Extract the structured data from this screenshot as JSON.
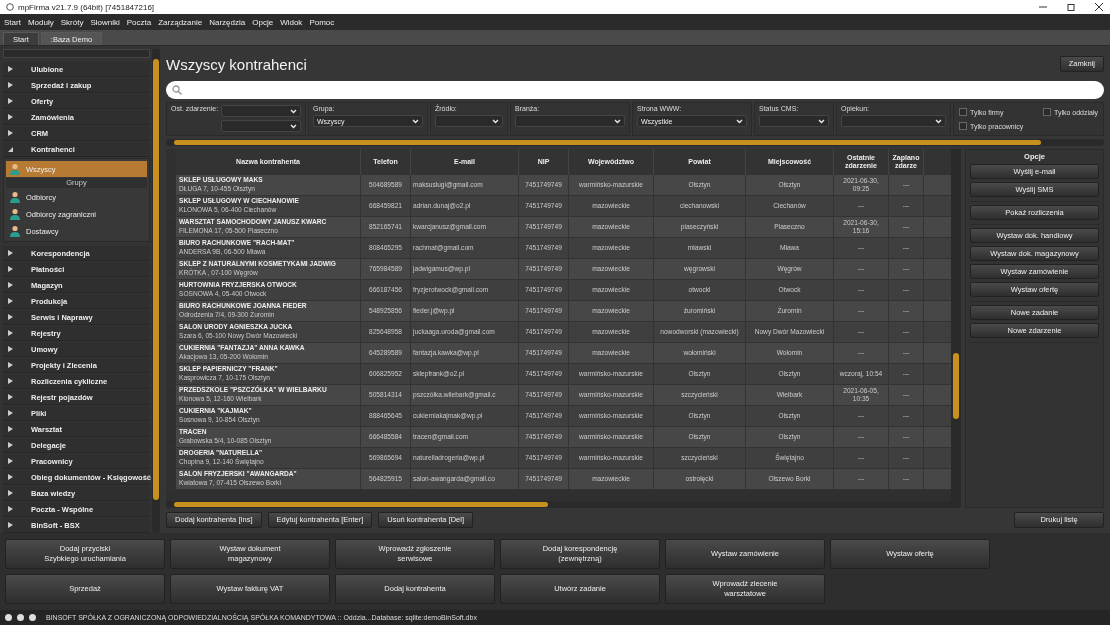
{
  "window": {
    "title": "mpFirma v21.7.9 (64bit) [7451847216]"
  },
  "menu": [
    "Start",
    "Moduły",
    "Skróty",
    "Słowniki",
    "Poczta",
    "Zarządzanie",
    "Narzędzia",
    "Opcje",
    "Widok",
    "Pomoc"
  ],
  "tabs": [
    {
      "label": "Start",
      "selected": false
    },
    {
      "label": ":Baza Demo",
      "selected": true
    }
  ],
  "sidebar": {
    "groups": [
      {
        "label": "Ulubione",
        "expanded": false
      },
      {
        "label": "Sprzedaż i zakup",
        "expanded": false
      },
      {
        "label": "Oferty",
        "expanded": false
      },
      {
        "label": "Zamówienia",
        "expanded": false
      },
      {
        "label": "CRM",
        "expanded": false
      },
      {
        "label": "Kontrahenci",
        "expanded": true,
        "children": [
          {
            "kind": "item",
            "label": "Wszyscy",
            "selected": true
          },
          {
            "kind": "header",
            "label": "Grupy"
          },
          {
            "kind": "item",
            "label": "Odbiorcy",
            "selected": false
          },
          {
            "kind": "item",
            "label": "Odbiorcy zagraniczni",
            "selected": false
          },
          {
            "kind": "item",
            "label": "Dostawcy",
            "selected": false
          }
        ]
      },
      {
        "label": "Korespondencja",
        "expanded": false
      },
      {
        "label": "Płatności",
        "expanded": false
      },
      {
        "label": "Magazyn",
        "expanded": false
      },
      {
        "label": "Produkcja",
        "expanded": false
      },
      {
        "label": "Serwis i Naprawy",
        "expanded": false
      },
      {
        "label": "Rejestry",
        "expanded": false
      },
      {
        "label": "Umowy",
        "expanded": false
      },
      {
        "label": "Projekty i Zlecenia",
        "expanded": false
      },
      {
        "label": "Rozliczenia cykliczne",
        "expanded": false
      },
      {
        "label": "Rejestr pojazdów",
        "expanded": false
      },
      {
        "label": "Pliki",
        "expanded": false
      },
      {
        "label": "Warsztat",
        "expanded": false
      },
      {
        "label": "Delegacje",
        "expanded": false
      },
      {
        "label": "Pracownicy",
        "expanded": false
      },
      {
        "label": "Obieg dokumentów - Księgowość",
        "expanded": false
      },
      {
        "label": "Baza wiedzy",
        "expanded": false
      },
      {
        "label": "Poczta - Wspólne",
        "expanded": false
      },
      {
        "label": "BinSoft - BSX",
        "expanded": false
      }
    ]
  },
  "page": {
    "title": "Wszyscy kontrahenci",
    "close_button": "Zamknij"
  },
  "filters": [
    {
      "kind": "side",
      "label": "Ost. zdarzenie:"
    },
    {
      "kind": "top",
      "label": "Grupa:",
      "value": "Wszyscy"
    },
    {
      "kind": "top",
      "label": "Źródło:"
    },
    {
      "kind": "top",
      "label": "Branża:"
    },
    {
      "kind": "top",
      "label": "Strona WWW:",
      "value": "Wszystkie"
    },
    {
      "kind": "top",
      "label": "Status CMS:"
    },
    {
      "kind": "top",
      "label": "Opiekun:"
    }
  ],
  "checkboxes": [
    {
      "label": "Tylko firmy",
      "checked": false
    },
    {
      "label": "Tylko oddziały",
      "checked": false
    },
    {
      "label": "Tylko pracownicy",
      "checked": false
    }
  ],
  "table": {
    "columns": [
      "Nazwa kontrahenta",
      "Telefon",
      "E-mail",
      "NIP",
      "Województwo",
      "Powiat",
      "Miejscowość",
      "Ostatnie zdarzenie",
      "Zaplano zdarze"
    ],
    "rows": [
      [
        "**SKLEP USŁUGOWY MAKS**\nDŁUGA 7, 10-455 Olsztyn",
        "504689589",
        "maksuslugi@gmail.com",
        "7451749749",
        "warmińsko-mazurskie",
        "Olsztyn",
        "Olsztyn",
        "2021-06-30, 09:25",
        "---"
      ],
      [
        "**SKLEP USŁUGOWY W CIECHANOWIE**\nKLONOWA 5, 06-400 Ciechanów",
        "668459821",
        "adrian.dunaj@o2.pl",
        "7451749749",
        "mazowieckie",
        "ciechanowski",
        "Ciechanów",
        "---",
        "---"
      ],
      [
        "**WARSZTAT SAMOCHODOWY JANUSZ KWARC**\nFILEMONA 17, 05-500 Piaseczno",
        "852165741",
        "kwarcjanusz@gmail.com",
        "7451749749",
        "mazowieckie",
        "piaseczyński",
        "Piaseczno",
        "2021-06-30, 15:16",
        "---"
      ],
      [
        "**BIURO RACHUNKOWE \"RACH-MAT\"**\nANDERSA 9B, 06-500 Mława",
        "808465295",
        "rachmat@gmail.com",
        "7451749749",
        "mazowieckie",
        "mławski",
        "Mława",
        "---",
        "---"
      ],
      [
        "**SKLEP Z NATURALNYMI KOSMETYKAMI JADWIG**\nKRÓTKA , 07-100 Węgrów",
        "765984589",
        "jadwigamus@wp.pl",
        "7451749749",
        "mazowieckie",
        "węgrowski",
        "Węgrów",
        "---",
        "---"
      ],
      [
        "**HURTOWNIA FRYZJERSKA OTWOCK**\nSOSNOWA 4, 05-400 Otwock",
        "666187456",
        "fryzjerotwock@gmail.com",
        "7451749749",
        "mazowieckie",
        "otwocki",
        "Otwock",
        "---",
        "---"
      ],
      [
        "**BIURO RACHUNKOWE JOANNA FIEDER**\nOdrodzenia 7/4, 09-300 Żuromin",
        "548925856",
        "fieder.j@wp.pl",
        "7451749749",
        "mazowieckie",
        "żuromiński",
        "Żuromin",
        "---",
        "---"
      ],
      [
        "**SALON URODY AGNIESZKA JUCKA**\nSzara 6, 05-100 Nowy Dwór Mazowiecki",
        "825648958",
        "juckaaga.uroda@gmail.com",
        "7451749749",
        "mazowieckie",
        "nowodworski (mazowiecki)",
        "Nowy Dwór Mazowiecki",
        "---",
        "---"
      ],
      [
        "**CUKIERNIA \"FANTAZJA\" ANNA KAWKA**\nAkacjowa 13, 05-200 Wołomin",
        "645289589",
        "fantazja.kawka@wp.pl",
        "7451749749",
        "mazowieckie",
        "wołomiński",
        "Wołomin",
        "---",
        "---"
      ],
      [
        "**SKLEP PAPIERNICZY \"FRANK\"**\nKasprowicza 7, 10-175 Olsztyn",
        "606825952",
        "sklepfrank@o2.pl",
        "7451749749",
        "warmińsko-mazurskie",
        "Olsztyn",
        "Olsztyn",
        "wczoraj, 10:54",
        "---"
      ],
      [
        "**PRZEDSZKOLE \"PSZCZÓŁKA\" W WIELBARKU**\nKlonowa 5, 12-160 Wielbark",
        "505814314",
        "pszczółka.wilebark@gmail.c",
        "7451749749",
        "warmińsko-mazurskie",
        "szczycieński",
        "Wielbark",
        "2021-06-05, 10:35",
        "---"
      ],
      [
        "**CUKIERNIA \"KAJMAK\"**\nSosnowa 9, 10-854 Olsztyn",
        "888465645",
        "cukierniakajmak@wp.pl",
        "7451749749",
        "warmińsko-mazurskie",
        "Olsztyn",
        "Olsztyn",
        "---",
        "---"
      ],
      [
        "**TRACEN**\nGrabowska 5/4, 10-085 Olsztyn",
        "666485584",
        "tracen@gmail.com",
        "7451749749",
        "warmińsko-mazurskie",
        "Olsztyn",
        "Olsztyn",
        "---",
        "---"
      ],
      [
        "**DROGERIA \"NATURELLA\"**\nChopina 9, 12-140 Świętajno",
        "569865694",
        "naturelladrogeria@wp.pl",
        "7451749749",
        "warmińsko-mazurskie",
        "szczycieński",
        "Świętajno",
        "---",
        "---"
      ],
      [
        "**SALON FRYZJERSKI \"AWANGARDA\"**\nKwiatowa 7, 07-415 Olszewo Borki",
        "564825915",
        "salon-awangarda@gmail.co",
        "7451749749",
        "mazowieckie",
        "ostrołęcki",
        "Olszewo Borki",
        "---",
        "---"
      ]
    ]
  },
  "options": {
    "title": "Opcje",
    "groups": [
      [
        "Wyślij e-mail",
        "Wyślij SMS"
      ],
      [
        "Pokaż rozliczenia"
      ],
      [
        "Wystaw dok. handlowy",
        "Wystaw dok. magazynowy",
        "Wystaw zamówienie",
        "Wystaw ofertę"
      ],
      [
        "Nowe zadanie",
        "Nowe zdarzenie"
      ]
    ]
  },
  "actions": [
    "Dodaj kontrahenta [Ins]",
    "Edytuj kontrahenta [Enter]",
    "Usuń kontrahenta [Del]"
  ],
  "print_button": "Drukuj listę",
  "quick_buttons": [
    [
      "Dodaj przyciski\nSzybkiego uruchamiania",
      "Wystaw dokument\nmagazynowy",
      "Wprowadź zgłoszenie\nserwisowe",
      "Dodaj korespondencję\n(zewnętrzną)",
      "Wystaw zamówienie",
      "Wystaw ofertę"
    ],
    [
      "Sprzedaż",
      "Wystaw fakturę VAT",
      "Dodaj kontrahenta",
      "Utwórz zadanie",
      "Wprowadź zlecenie\nwarsztatowe"
    ]
  ],
  "status_bar": "BINSOFT SPÓŁKA Z OGRANICZONĄ ODPOWIEDZIALNOŚCIĄ SPÓŁKA KOMANDYTOWA :: Oddzia...Database: sqlite:demoBinSoft.dbx"
}
